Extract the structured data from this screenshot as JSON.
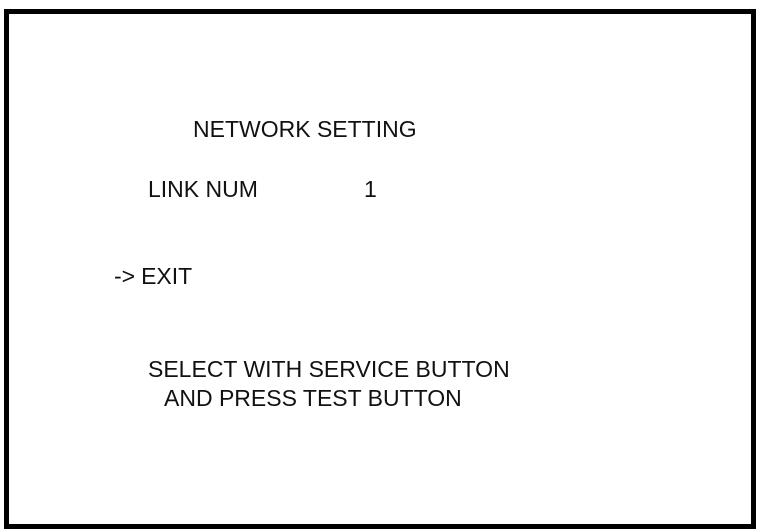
{
  "menu": {
    "title": "NETWORK SETTING",
    "link_num": {
      "label": "LINK NUM",
      "value": "1"
    },
    "cursor": "->",
    "exit_label": "EXIT",
    "instructions": {
      "line1": "SELECT WITH SERVICE BUTTON",
      "line2": "AND PRESS TEST BUTTON"
    }
  }
}
